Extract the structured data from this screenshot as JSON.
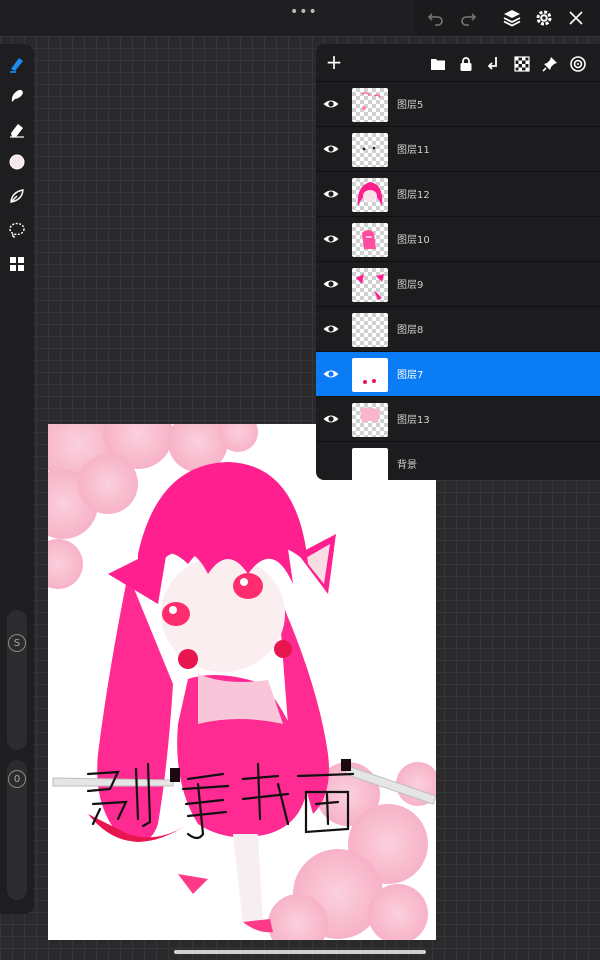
{
  "topbar": {
    "menu_dots": "•••",
    "icons": [
      "undo-icon",
      "redo-icon",
      "layers-icon",
      "settings-icon",
      "close-icon"
    ]
  },
  "sidebar": {
    "tools": [
      "brush-icon",
      "smudge-icon",
      "eraser-icon",
      "color-swatch",
      "selection-icon",
      "lasso-icon",
      "gallery-icon"
    ],
    "size_slider_label": "S",
    "opacity_slider_label": "0",
    "color_swatch": "#f6e8ea"
  },
  "layers_panel": {
    "toolbar_icons": [
      "add-layer-icon",
      "folder-icon",
      "lock-icon",
      "merge-down-icon",
      "checker-icon",
      "pin-icon",
      "target-icon"
    ],
    "add_label": "+",
    "layers": [
      {
        "name": "图层5",
        "visible": true,
        "selected": false
      },
      {
        "name": "图层11",
        "visible": true,
        "selected": false
      },
      {
        "name": "图层12",
        "visible": true,
        "selected": false
      },
      {
        "name": "图层10",
        "visible": true,
        "selected": false
      },
      {
        "name": "图层9",
        "visible": true,
        "selected": false
      },
      {
        "name": "图层8",
        "visible": true,
        "selected": false
      },
      {
        "name": "图层7",
        "visible": true,
        "selected": true
      },
      {
        "name": "图层13",
        "visible": true,
        "selected": false
      },
      {
        "name": "背景",
        "visible": false,
        "selected": false
      }
    ],
    "selected_color": "#0a7cf5"
  },
  "canvas": {
    "handwritten_text": "别学我画",
    "accent_color": "#ff1f8e"
  }
}
